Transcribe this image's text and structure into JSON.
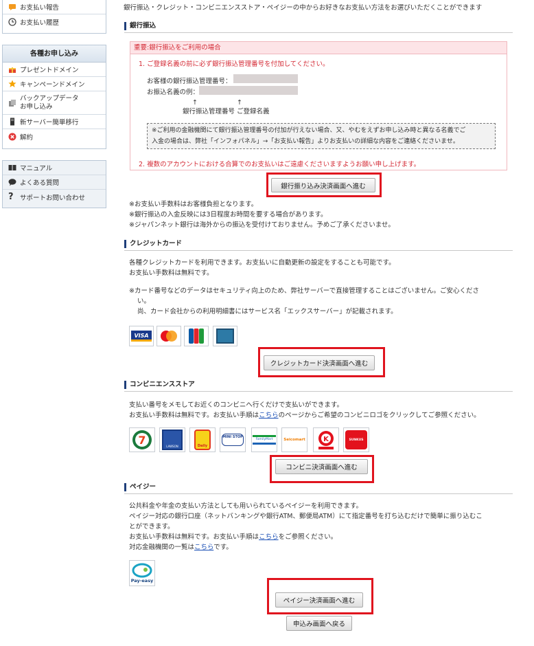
{
  "sidebar": {
    "top_items": [
      {
        "label": "お支払い報告",
        "icon": "report-icon"
      },
      {
        "label": "お支払い履歴",
        "icon": "clock-icon"
      }
    ],
    "applications": {
      "title": "各種お申し込み",
      "items": [
        {
          "label": "プレゼントドメイン",
          "icon": "gift-icon"
        },
        {
          "label": "キャンペーンドメイン",
          "icon": "star-icon"
        },
        {
          "label": "バックアップデータ",
          "label2": "お申し込み",
          "icon": "backup-icon"
        },
        {
          "label": "新サーバー簡単移行",
          "icon": "server-icon"
        },
        {
          "label": "解約",
          "icon": "cancel-icon"
        }
      ]
    },
    "support": [
      {
        "label": "マニュアル",
        "icon": "book-icon"
      },
      {
        "label": "よくある質問",
        "icon": "chat-icon"
      },
      {
        "label": "サポートお問い合わせ",
        "icon": "question-icon"
      }
    ]
  },
  "intro": "銀行振込・クレジット・コンビニエンスストア・ペイジーの中からお好きなお支払い方法をお選びいただくことができます",
  "bank": {
    "heading": "銀行振込",
    "notice_title": "重要:銀行振込をご利用の場合",
    "step1": "1. ご登録名義の前に必ず銀行振込管理番号を付加してください。",
    "mgmt_label": "お客様の銀行振込管理番号：",
    "example_label": "お振込名義の例：",
    "arrows": "↑　　　　　　↑",
    "arrow_caption": "銀行振込管理番号 ご登録名義",
    "dotted_line1": "※ご利用の金融機関にて銀行振込管理番号の付加が行えない場合、又、やむをえずお申し込み時と異なる名義でご",
    "dotted_line2": "入金の場合は、弊社「インフォパネル」→「お支払い報告」よりお支払いの詳細な内容をご連絡くださいませ。",
    "step2": "2. 複数のアカウントにおける合算でのお支払いはご遠慮くださいますようお願い申し上げます。",
    "button": "銀行振り込み決済画面へ進む",
    "notes": [
      "※お支払い手数料はお客様負担となります。",
      "※銀行振込の入金反映には3日程度お時間を要する場合があります。",
      "※ジャパンネット銀行は海外からの振込を受付けておりません。予めご了承くださいませ。"
    ]
  },
  "credit": {
    "heading": "クレジットカード",
    "text1": "各種クレジットカードを利用できます。お支払いに自動更新の設定をすることも可能です。",
    "text2": "お支払い手数料は無料です。",
    "note1": "※カード番号などのデータはセキュリティ向上のため、弊社サーバーで直接管理することはございません。ご安心くださ",
    "note2": "い。",
    "note3": "尚、カード会社からの利用明細書にはサービス名「エックスサーバー」が記載されます。",
    "cards": [
      "VISA",
      "MasterCard",
      "JCB",
      "AMEX"
    ],
    "button": "クレジットカード決済画面へ進む"
  },
  "convenience": {
    "heading": "コンビニエンスストア",
    "text1": "支払い番号をメモしてお近くのコンビニへ行くだけで支払いができます。",
    "text2_pre": "お支払い手数料は無料です。お支払い手順は",
    "text2_link": "こちら",
    "text2_post": "のページからご希望のコンビニロゴをクリックしてご参照ください。",
    "stores": [
      "7",
      "LAWSON",
      "Daily",
      "MINI STOP",
      "FamilyMart",
      "Seicomart",
      "K",
      "SUNKUS"
    ],
    "button": "コンビニ決済画面へ進む"
  },
  "payeasy": {
    "heading": "ペイジー",
    "text1": "公共料金や年金の支払い方法としても用いられているペイジーを利用できます。",
    "text2": "ペイジー対応の銀行口座（ネットバンキングや銀行ATM、郵便局ATM）にて指定番号を打ち込むだけで簡単に振り込むこ",
    "text3": "とができます。",
    "text4_pre": "お支払い手数料は無料です。お支払い手順は",
    "text4_link": "こちら",
    "text4_post": "をご参照ください。",
    "text5_pre": "対応金融機関の一覧は",
    "text5_link": "こちら",
    "text5_post": "です。",
    "logo_text": "Pay-easy",
    "button": "ペイジー決済画面へ進む"
  },
  "back_button": "申込み画面へ戻る"
}
